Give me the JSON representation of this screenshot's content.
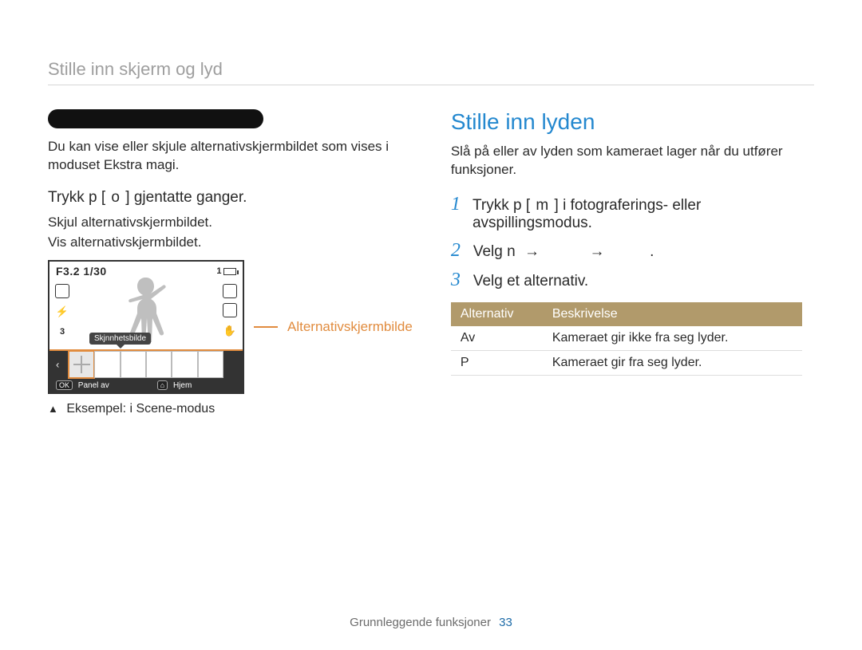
{
  "page_header": "Stille inn skjerm og lyd",
  "footer": {
    "text": "Grunnleggende funksjoner",
    "page_number": "33"
  },
  "left": {
    "intro": "Du kan vise eller skjule alternativskjermbildet som vises i moduset Ekstra magi.",
    "instruction_parts": {
      "prefix": "Trykk p",
      "key_label": "o",
      "suffix": "gjentatte ganger."
    },
    "bullets": [
      "Skjul alternativskjermbildet.",
      "Vis alternativskjermbildet."
    ],
    "lcd": {
      "top_text": "F3.2 1/30",
      "frame_count": "1",
      "tooltip_label": "Skjnnhetsbilde",
      "bottom": {
        "ok_label": "OK",
        "panel_label": "Panel av",
        "home_label": "Hjem"
      }
    },
    "callout": "Alternativskjermbilde",
    "caption": "Eksempel: i Scene-modus"
  },
  "right": {
    "heading": "Stille inn lyden",
    "intro": "Slå på eller av lyden som kameraet lager når du utfører funksjoner.",
    "steps": [
      {
        "prefix": "Trykk p",
        "key_label": "m",
        "suffix": "i fotograferings- eller avspillingsmodus."
      },
      {
        "prefix": "Velg n",
        "suffix_end": "."
      },
      {
        "text": "Velg et alternativ."
      }
    ],
    "table": {
      "headers": [
        "Alternativ",
        "Beskrivelse"
      ],
      "rows": [
        [
          "Av",
          "Kameraet gir ikke fra seg lyder."
        ],
        [
          "P",
          "Kameraet gir fra seg lyder."
        ]
      ]
    }
  }
}
